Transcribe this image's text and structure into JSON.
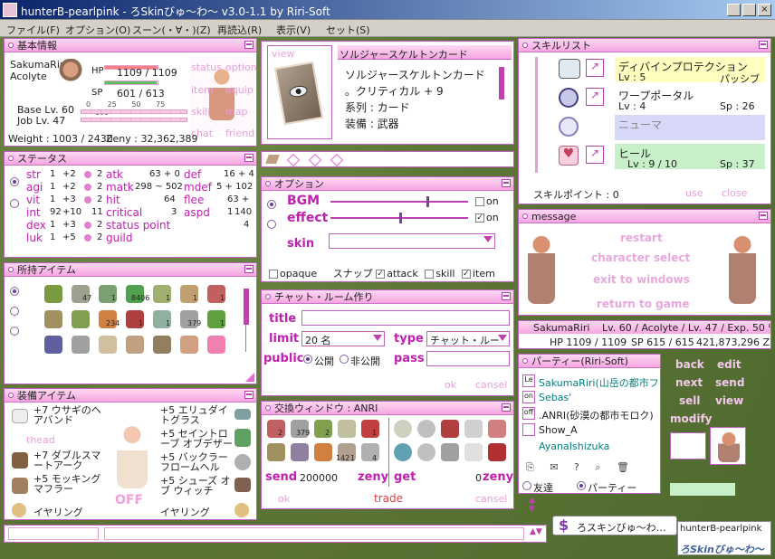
{
  "app": {
    "title": "hunterB-pearlpink - ろSkinびゅ〜わ〜 v3.0-1.1 by Riri-Soft"
  },
  "menu": [
    "ファイル(F)",
    "オプション(O)",
    "スーン(・∀・)(Z)",
    "再読込(R)",
    "表示(V)",
    "セット(S)"
  ],
  "basic": {
    "title": "基本情報",
    "name": "SakumaRiri",
    "job": "Acolyte",
    "hp_label": "HP",
    "hp": "1109 / 1109",
    "hp_fill": 1.0,
    "sp_label": "SP",
    "sp": "601 / 613",
    "sp_fill": 0.98,
    "base": "Base Lv. 60",
    "joblv": "Job Lv. 47",
    "scale": [
      "0",
      "25",
      "50",
      "75",
      "100"
    ],
    "weight": "Weight : 1003 / 2430",
    "zeny": "Zeny : 32,362,389",
    "side": [
      "status",
      "option",
      "item",
      "equip",
      "skill",
      "map",
      "chat",
      "friend"
    ]
  },
  "status": {
    "title": "ステータス",
    "stats": [
      {
        "n": "str",
        "v": "1",
        "b": "+2",
        "p": "2"
      },
      {
        "n": "agi",
        "v": "1",
        "b": "+2",
        "p": "2"
      },
      {
        "n": "vit",
        "v": "1",
        "b": "+3",
        "p": "2"
      },
      {
        "n": "int",
        "v": "92",
        "b": "+10",
        "p": "11"
      },
      {
        "n": "dex",
        "v": "1",
        "b": "+3",
        "p": "2"
      },
      {
        "n": "luk",
        "v": "1",
        "b": "+5",
        "p": "2"
      }
    ],
    "mid": [
      {
        "n": "atk",
        "v": "63 + 0"
      },
      {
        "n": "matk",
        "v": "298 ~ 502"
      },
      {
        "n": "hit",
        "v": "64"
      },
      {
        "n": "critical",
        "v": "3"
      },
      {
        "n": "status point",
        "v": "4"
      },
      {
        "n": "guild",
        "v": ""
      }
    ],
    "right": [
      {
        "n": "def",
        "v": "16 + 4"
      },
      {
        "n": "mdef",
        "v": "5 + 102"
      },
      {
        "n": "flee",
        "v": "63 + 1"
      },
      {
        "n": "aspd",
        "v": "140"
      }
    ]
  },
  "items": {
    "title": "所持アイテム",
    "counts": [
      "47",
      "1",
      "8406",
      "1",
      "1",
      "1",
      "234",
      "1",
      "1",
      "379",
      "1"
    ]
  },
  "equip": {
    "title": "装備アイテム",
    "left": [
      "+7 ウサギのヘアバンド",
      "thead",
      "+7 ダブルスマートアーク",
      "+5 モッキングマフラー",
      "イヤリング"
    ],
    "right": [
      "+5 エリュダイトグラス",
      "+5 セイントローブ オブデザー",
      "+5 バックラーフロームヘル",
      "+5 シューズ オブ ウィッチ",
      "イヤリング"
    ],
    "off": "OFF"
  },
  "card": {
    "title": "ソルジャースケルトンカード",
    "view": "view",
    "name": "ソルジャースケルトンカード",
    "line1": "。クリティカル + 9",
    "line2": "系列 : カード",
    "line3": "装備 : 武器"
  },
  "option": {
    "title": "オプション",
    "bgm": "BGM",
    "effect": "effect",
    "skin": "skin",
    "on1": "on",
    "on2": "on",
    "bgm_level": 0.7,
    "effect_level": 0.5,
    "checks": [
      "opaque",
      "スナップ",
      "attack",
      "skill",
      "item"
    ]
  },
  "chat": {
    "title": "チャット・ルーム作り",
    "title_lbl": "title",
    "limit": "limit",
    "limit_val": "20 名",
    "type": "type",
    "type_val": "チャット・ルー",
    "public": "public",
    "pub1": "公開",
    "pub2": "非公開",
    "pass": "pass",
    "ok": "ok",
    "cancel": "cansel"
  },
  "trade": {
    "title": "交換ウィンドウ : ANRI",
    "send": "send",
    "send_val": "200000",
    "zeny": "zeny",
    "get": "get",
    "get_val": "0",
    "zeny2": "zeny",
    "ok": "ok",
    "trade": "trade",
    "cancel": "cansel",
    "counts": [
      "2",
      "379",
      "2",
      "1",
      "142",
      "1",
      "4"
    ]
  },
  "skills": {
    "title": "スキルリスト",
    "list": [
      {
        "name": "ディバインプロテクション",
        "lv": "Lv : 5",
        "extra": "パッシブ"
      },
      {
        "name": "ワープポータル",
        "lv": "Lv : 4",
        "extra": "Sp : 26"
      },
      {
        "name": "ニューマ",
        "lv": "",
        "extra": ""
      },
      {
        "name": "ヒール",
        "lv": "Lv : 9 / 10",
        "extra": "Sp : 37"
      }
    ],
    "points": "スキルポイント : 0",
    "use": "use",
    "close": "close"
  },
  "message": {
    "title": "message",
    "b": [
      "restart",
      "character select",
      "exit to windows",
      "return to game"
    ]
  },
  "charinfo": {
    "name": "SakumaRiri",
    "lv": "Lv. 60 / Acolyte / Lv. 47 / Exp. 50 %",
    "hp": "HP 1109 / 1109",
    "sp": "SP 615 / 615",
    "z": "421,873,296 Z"
  },
  "party": {
    "title": "パーティー(Riri-Soft)",
    "members": [
      {
        "tag": "Le",
        "name": "SakumaRiri(山岳の都市フェ",
        "c": "#008080"
      },
      {
        "tag": "on",
        "name": "Sebas'",
        "c": "#008080"
      },
      {
        "tag": "off",
        "name": ".ANRI(砂漠の都市モロク)",
        "c": "#222"
      },
      {
        "tag": "",
        "name": "Show_A",
        "c": "#222"
      },
      {
        "tag": "",
        "name": "AyanaIshizuka",
        "c": "#008080"
      }
    ],
    "tab1": "友達",
    "tab2": "パーティー",
    "acts": [
      "back",
      "edit",
      "next",
      "send",
      "sell",
      "view",
      "modify"
    ]
  },
  "taskbar": {
    "task1": "ろスキンびゅ〜わ…",
    "title": "hunterB-pearlpink",
    "brand": "ろSkinびゅ〜わ〜"
  }
}
